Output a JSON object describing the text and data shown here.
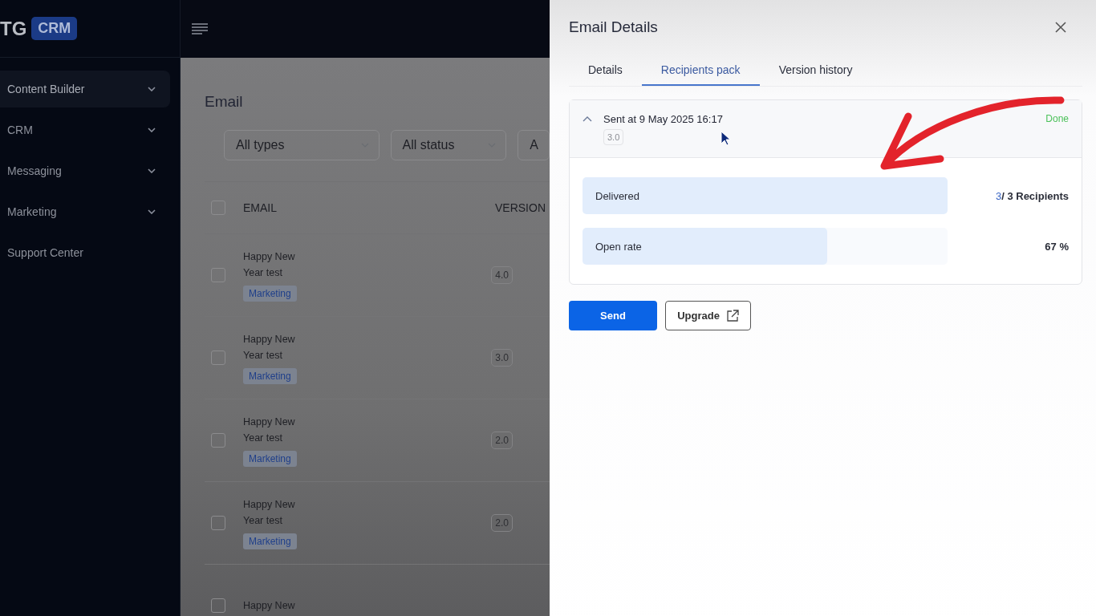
{
  "logo": {
    "text": "TG",
    "badge": "CRM"
  },
  "sidebar": {
    "items": [
      {
        "label": "Content Builder",
        "selected": true,
        "expandable": true
      },
      {
        "label": "CRM",
        "selected": false,
        "expandable": true
      },
      {
        "label": "Messaging",
        "selected": false,
        "expandable": true
      },
      {
        "label": "Marketing",
        "selected": false,
        "expandable": true
      },
      {
        "label": "Support Center",
        "selected": false,
        "expandable": false
      }
    ]
  },
  "page": {
    "title": "Email",
    "filters": [
      "All types",
      "All status",
      "A"
    ],
    "table": {
      "columns": [
        "EMAIL",
        "VERSION"
      ],
      "all_checked": false,
      "rows": [
        {
          "email": "Happy New Year test",
          "tag": "Marketing",
          "version": "4.0",
          "checked": false
        },
        {
          "email": "Happy New Year test",
          "tag": "Marketing",
          "version": "3.0",
          "checked": false
        },
        {
          "email": "Happy New Year test",
          "tag": "Marketing",
          "version": "2.0",
          "checked": false
        },
        {
          "email": "Happy New Year test",
          "tag": "Marketing",
          "version": "2.0",
          "checked": false
        },
        {
          "email": "Happy New",
          "checked": false
        }
      ]
    }
  },
  "drawer": {
    "title": "Email Details",
    "tabs": [
      {
        "label": "Details",
        "selected": false
      },
      {
        "label": "Recipients pack",
        "selected": true
      },
      {
        "label": "Version history",
        "selected": false
      }
    ],
    "pack": {
      "title": "Sent at 9 May 2025 16:17",
      "version": "3.0",
      "status": "Done",
      "expanded": true,
      "stats": [
        {
          "label": "Delivered",
          "level": 1,
          "count": "3",
          "reading": "/ 3 Recipients"
        },
        {
          "label": "Open rate",
          "level": 0.67,
          "reading": "67 %"
        }
      ]
    },
    "buttons": [
      {
        "label": "Send",
        "kind": "primary"
      },
      {
        "label": "Upgrade",
        "kind": "external"
      }
    ]
  }
}
